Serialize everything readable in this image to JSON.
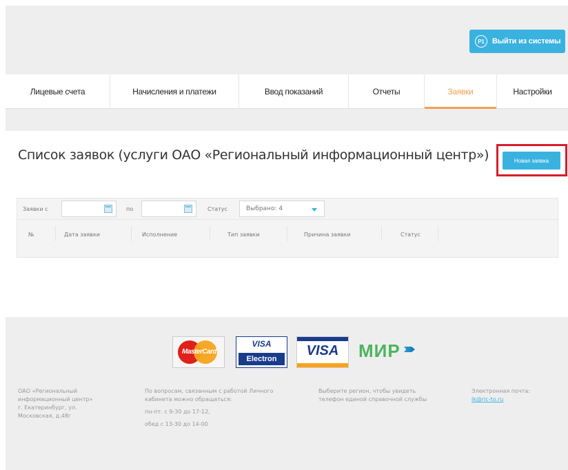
{
  "header": {
    "logout": {
      "label": "Выйти из системы",
      "icon_text": "Р1"
    }
  },
  "nav": {
    "tabs": [
      {
        "label": "Лицевые счета",
        "active": false
      },
      {
        "label": "Начисления и платежи",
        "active": false
      },
      {
        "label": "Ввод показаний",
        "active": false
      },
      {
        "label": "Отчеты",
        "active": false
      },
      {
        "label": "Заявки",
        "active": true
      },
      {
        "label": "Настройки",
        "active": false
      }
    ]
  },
  "main": {
    "title": "Список заявок (услуги ОАО «Региональный информационный центр»)",
    "new_request_button": "Новая заявка"
  },
  "filters": {
    "from_label": "Заявки с",
    "to_label": "по",
    "from_value": "",
    "to_value": "",
    "status_label": "Статус",
    "status_value": "Выбрано: 4"
  },
  "table": {
    "columns": [
      "№",
      "Дата заявки",
      "Исполнение",
      "Тип заявки",
      "Причина заявки",
      "Статус"
    ]
  },
  "footer": {
    "cards": {
      "mastercard": "MasterCard",
      "visa_electron_top": "VISA",
      "visa_electron_bottom": "Electron",
      "visa": "VISA",
      "mir": "МИР"
    },
    "company": [
      "ОАО «Региональный",
      "информационный центр»",
      "г. Екатеринбург, ул.",
      "Московская, д.48г"
    ],
    "support": [
      "По вопросам, связанным с работой Личного",
      "кабинета можно обращаться:",
      "пн-пт. с 9-30 до 17-12,",
      "обед с 13-30 до 14-00"
    ],
    "region": [
      "Выберите регион, чтобы увидеть",
      "телефон единой справочной службы"
    ],
    "email_label": "Электронная почта:",
    "email": "lk@ric-to.ru"
  },
  "colors": {
    "accent": "#3ab2e0",
    "active_tab": "#f0a050",
    "highlight_border": "#d71d2b",
    "page_gray": "#eeeeee"
  }
}
